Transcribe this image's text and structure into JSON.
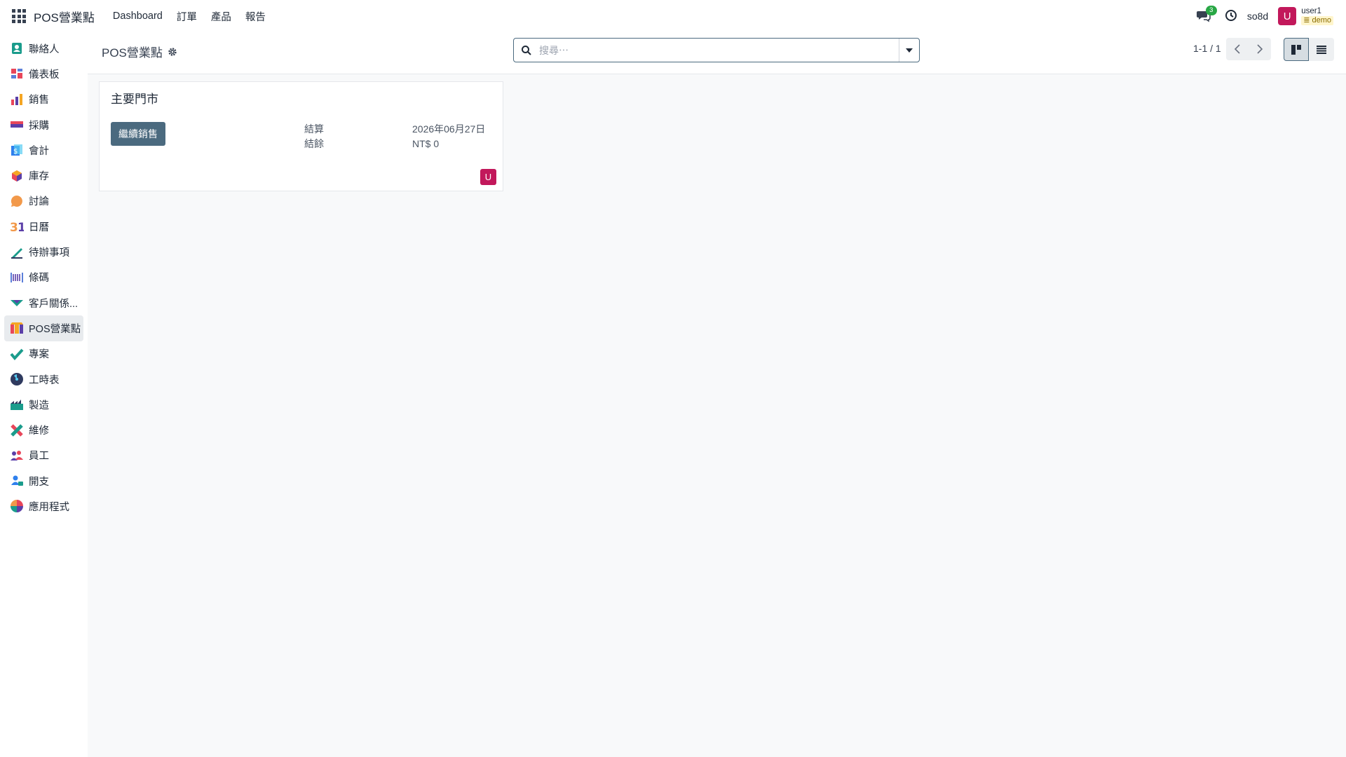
{
  "topbar": {
    "apps_icon": "grid-icon",
    "brand": "POS營業點",
    "menu": [
      "Dashboard",
      "訂單",
      "產品",
      "報告"
    ],
    "chat_count": "3",
    "db_name": "so8d",
    "avatar_letter": "U",
    "user_name": "user1",
    "user_db": "demo"
  },
  "sidebar": {
    "items": [
      {
        "label": "聯絡人",
        "icon": "contacts-icon"
      },
      {
        "label": "儀表板",
        "icon": "dashboard-icon"
      },
      {
        "label": "銷售",
        "icon": "sales-icon"
      },
      {
        "label": "採購",
        "icon": "purchase-icon"
      },
      {
        "label": "會計",
        "icon": "accounting-icon"
      },
      {
        "label": "庫存",
        "icon": "inventory-icon"
      },
      {
        "label": "討論",
        "icon": "discuss-icon"
      },
      {
        "label": "日曆",
        "icon": "calendar-icon"
      },
      {
        "label": "待辦事項",
        "icon": "todo-icon"
      },
      {
        "label": "條碼",
        "icon": "barcode-icon"
      },
      {
        "label": "客戶關係...",
        "icon": "crm-icon"
      },
      {
        "label": "POS營業點",
        "icon": "pos-icon"
      },
      {
        "label": "專案",
        "icon": "project-icon"
      },
      {
        "label": "工時表",
        "icon": "timesheet-icon"
      },
      {
        "label": "製造",
        "icon": "manufacturing-icon"
      },
      {
        "label": "維修",
        "icon": "repair-icon"
      },
      {
        "label": "員工",
        "icon": "employees-icon"
      },
      {
        "label": "開支",
        "icon": "expenses-icon"
      },
      {
        "label": "應用程式",
        "icon": "apps-icon"
      }
    ],
    "active_index": 11
  },
  "control": {
    "title": "POS營業點",
    "search_placeholder": "搜尋⋯",
    "pager": "1-1 / 1"
  },
  "card": {
    "title": "主要門市",
    "button": "繼續銷售",
    "label_closing": "結算",
    "label_balance": "結餘",
    "value_closing": "2026年06月27日",
    "value_balance": "NT$ 0",
    "avatar_letter": "U"
  },
  "colors": {
    "primary": "#4b6a7f",
    "avatar": "#c2185b",
    "badge": "#28a745"
  }
}
